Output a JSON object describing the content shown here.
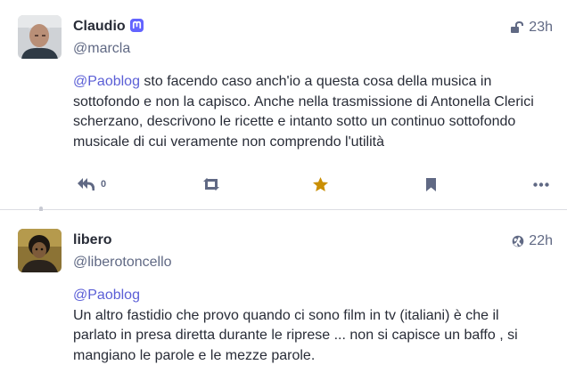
{
  "statuses": [
    {
      "display_name": "Claudio",
      "acct": "@marcla",
      "time": "23h",
      "visibility": "unlisted-lock-icon",
      "mention": "@Paoblog",
      "text": " sto facendo caso anch'io a questa cosa della musica in sottofondo e non la capisco. Anche nella trasmissione di Antonella Clerici scherzano, descrivono le ricette e intanto sotto un continuo sottofondo musicale di cui veramente non comprendo l'utilità",
      "reply_count": "0",
      "favourited": true
    },
    {
      "display_name": "libero",
      "acct": "@liberotoncello",
      "time": "22h",
      "visibility": "globe-icon",
      "mention": "@Paoblog",
      "text": "Un altro fastidio che provo quando ci sono film in tv (italiani) è che il parlato in presa diretta durante le riprese ... non si capisce un baffo , si mangiano le parole e le mezze parole."
    }
  ],
  "colors": {
    "accent": "#5b5fd6",
    "star": "#ca8f04",
    "icon": "#606984",
    "divider": "#dcdde3",
    "mastodon": "#6364ff"
  }
}
